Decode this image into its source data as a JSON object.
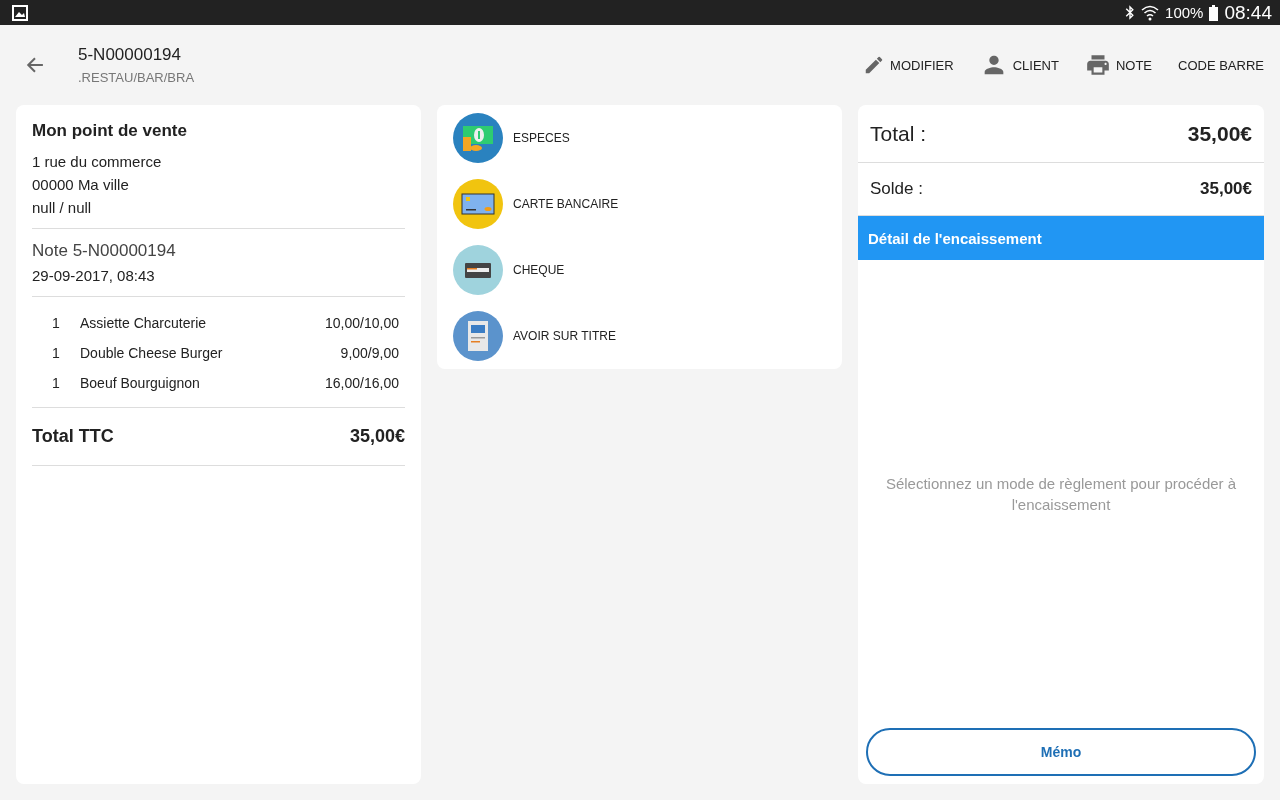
{
  "status_bar": {
    "battery": "100%",
    "time": "08:44"
  },
  "header": {
    "title": "5-N00000194",
    "subtitle": ".RESTAU/BAR/BRA",
    "actions": [
      {
        "kind": "edit",
        "label": "MODIFIER"
      },
      {
        "kind": "person",
        "label": "CLIENT"
      },
      {
        "kind": "print",
        "label": "NOTE"
      },
      {
        "kind": "none",
        "label": "CODE BARRE"
      }
    ]
  },
  "receipt": {
    "shop": "Mon point de vente",
    "address": [
      "1 rue du commerce",
      "00000 Ma ville",
      "null / null"
    ],
    "note": "Note 5-N00000194",
    "date": "29-09-2017, 08:43",
    "items": [
      {
        "qty": "1",
        "name": "Assiette Charcuterie",
        "price": "10,00/10,00"
      },
      {
        "qty": "1",
        "name": "Double Cheese Burger",
        "price": "9,00/9,00"
      },
      {
        "qty": "1",
        "name": "Boeuf Bourguignon",
        "price": "16,00/16,00"
      }
    ],
    "total_label": "Total TTC",
    "total": "35,00€"
  },
  "payment_methods": [
    {
      "kind": "cash",
      "label": "ESPECES",
      "color": "#2a82bf"
    },
    {
      "kind": "card",
      "label": "CARTE BANCAIRE",
      "color": "#f1c40f"
    },
    {
      "kind": "cheque",
      "label": "CHEQUE",
      "color": "#9fd3dd"
    },
    {
      "kind": "voucher",
      "label": "AVOIR SUR TITRE",
      "color": "#5b93cc"
    }
  ],
  "summary": {
    "total_label": "Total :",
    "total": "35,00€",
    "balance_label": "Solde :",
    "balance": "35,00€",
    "detail_title": "Détail de l'encaissement",
    "hint": "Sélectionnez un mode de règlement pour procéder à l'encaissement",
    "memo": "Mémo"
  }
}
